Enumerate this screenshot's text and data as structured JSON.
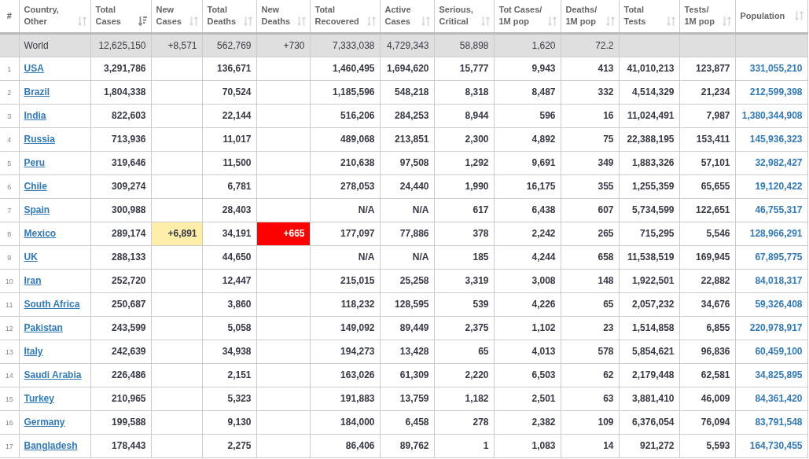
{
  "table": {
    "columns": [
      {
        "label": "#"
      },
      {
        "label": "Country,\nOther",
        "sorted": false
      },
      {
        "label": "Total\nCases",
        "sorted": true
      },
      {
        "label": "New\nCases",
        "sorted": false
      },
      {
        "label": "Total\nDeaths",
        "sorted": false
      },
      {
        "label": "New\nDeaths",
        "sorted": false
      },
      {
        "label": "Total\nRecovered",
        "sorted": false
      },
      {
        "label": "Active\nCases",
        "sorted": false
      },
      {
        "label": "Serious,\nCritical",
        "sorted": false
      },
      {
        "label": "Tot Cases/\n1M pop",
        "sorted": false
      },
      {
        "label": "Deaths/\n1M pop",
        "sorted": false
      },
      {
        "label": "Total\nTests",
        "sorted": false
      },
      {
        "label": "Tests/\n1M pop",
        "sorted": false
      },
      {
        "label": "Population",
        "sorted": false
      }
    ],
    "rows": [
      {
        "kind": "total",
        "cells": [
          null,
          "World",
          "12,625,150",
          "+8,571",
          "562,769",
          "+730",
          "7,333,038",
          "4,729,343",
          "58,898",
          "1,620",
          "72.2",
          null,
          null,
          null
        ]
      },
      {
        "kind": "country",
        "cells": [
          "1",
          "USA",
          "3,291,786",
          null,
          "136,671",
          null,
          "1,460,495",
          "1,694,620",
          "15,777",
          "9,943",
          "413",
          "41,010,213",
          "123,877",
          "331,055,210"
        ]
      },
      {
        "kind": "country",
        "cells": [
          "2",
          "Brazil",
          "1,804,338",
          null,
          "70,524",
          null,
          "1,185,596",
          "548,218",
          "8,318",
          "8,487",
          "332",
          "4,514,329",
          "21,234",
          "212,599,398"
        ]
      },
      {
        "kind": "country",
        "cells": [
          "3",
          "India",
          "822,603",
          null,
          "22,144",
          null,
          "516,206",
          "284,253",
          "8,944",
          "596",
          "16",
          "11,024,491",
          "7,987",
          "1,380,344,908"
        ]
      },
      {
        "kind": "country",
        "cells": [
          "4",
          "Russia",
          "713,936",
          null,
          "11,017",
          null,
          "489,068",
          "213,851",
          "2,300",
          "4,892",
          "75",
          "22,388,195",
          "153,411",
          "145,936,323"
        ]
      },
      {
        "kind": "country",
        "cells": [
          "5",
          "Peru",
          "319,646",
          null,
          "11,500",
          null,
          "210,638",
          "97,508",
          "1,292",
          "9,691",
          "349",
          "1,883,326",
          "57,101",
          "32,982,427"
        ]
      },
      {
        "kind": "country",
        "cells": [
          "6",
          "Chile",
          "309,274",
          null,
          "6,781",
          null,
          "278,053",
          "24,440",
          "1,990",
          "16,175",
          "355",
          "1,255,359",
          "65,655",
          "19,120,422"
        ]
      },
      {
        "kind": "country",
        "cells": [
          "7",
          "Spain",
          "300,988",
          null,
          "28,403",
          null,
          "N/A",
          "N/A",
          "617",
          "6,438",
          "607",
          "5,734,599",
          "122,651",
          "46,755,317"
        ]
      },
      {
        "kind": "country",
        "cells": [
          "8",
          "Mexico",
          "289,174",
          "+6,891",
          "34,191",
          "+665",
          "177,097",
          "77,886",
          "378",
          "2,242",
          "265",
          "715,295",
          "5,546",
          "128,966,291"
        ]
      },
      {
        "kind": "country",
        "cells": [
          "9",
          "UK",
          "288,133",
          null,
          "44,650",
          null,
          "N/A",
          "N/A",
          "185",
          "4,244",
          "658",
          "11,538,519",
          "169,945",
          "67,895,775"
        ]
      },
      {
        "kind": "country",
        "cells": [
          "10",
          "Iran",
          "252,720",
          null,
          "12,447",
          null,
          "215,015",
          "25,258",
          "3,319",
          "3,008",
          "148",
          "1,922,501",
          "22,882",
          "84,018,317"
        ]
      },
      {
        "kind": "country",
        "cells": [
          "11",
          "South Africa",
          "250,687",
          null,
          "3,860",
          null,
          "118,232",
          "128,595",
          "539",
          "4,226",
          "65",
          "2,057,232",
          "34,676",
          "59,326,408"
        ]
      },
      {
        "kind": "country",
        "cells": [
          "12",
          "Pakistan",
          "243,599",
          null,
          "5,058",
          null,
          "149,092",
          "89,449",
          "2,375",
          "1,102",
          "23",
          "1,514,858",
          "6,855",
          "220,978,917"
        ]
      },
      {
        "kind": "country",
        "cells": [
          "13",
          "Italy",
          "242,639",
          null,
          "34,938",
          null,
          "194,273",
          "13,428",
          "65",
          "4,013",
          "578",
          "5,854,621",
          "96,836",
          "60,459,100"
        ]
      },
      {
        "kind": "country",
        "cells": [
          "14",
          "Saudi Arabia",
          "226,486",
          null,
          "2,151",
          null,
          "163,026",
          "61,309",
          "2,220",
          "6,503",
          "62",
          "2,179,448",
          "62,581",
          "34,825,895"
        ]
      },
      {
        "kind": "country",
        "cells": [
          "15",
          "Turkey",
          "210,965",
          null,
          "5,323",
          null,
          "191,883",
          "13,759",
          "1,182",
          "2,501",
          "63",
          "3,881,410",
          "46,009",
          "84,361,420"
        ]
      },
      {
        "kind": "country",
        "cells": [
          "16",
          "Germany",
          "199,588",
          null,
          "9,130",
          null,
          "184,000",
          "6,458",
          "278",
          "2,382",
          "109",
          "6,376,054",
          "76,094",
          "83,791,548"
        ]
      },
      {
        "kind": "country",
        "cells": [
          "17",
          "Bangladesh",
          "178,443",
          null,
          "2,275",
          null,
          "86,406",
          "89,762",
          "1",
          "1,083",
          "14",
          "921,272",
          "5,593",
          "164,730,455"
        ]
      }
    ]
  }
}
